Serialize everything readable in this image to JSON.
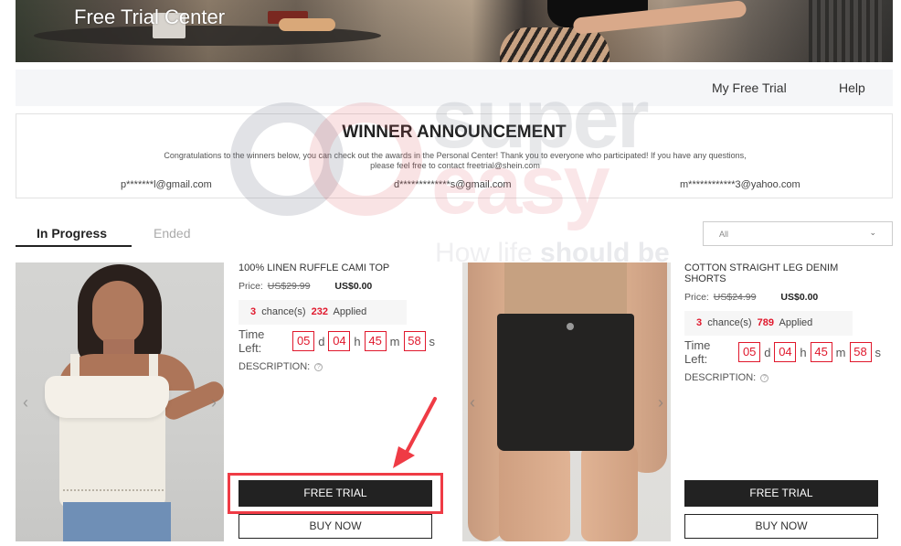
{
  "banner": {
    "title": "Free Trial Center"
  },
  "navbar": {
    "links": [
      {
        "label": "My Free Trial"
      },
      {
        "label": "Help"
      }
    ]
  },
  "announcement": {
    "title": "WINNER ANNOUNCEMENT",
    "text": "Congratulations to the winners below, you can check out the awards in the Personal Center! Thank you to everyone who participated! If you have any questions, please feel free to contact freetrial@shein.com",
    "winners": [
      "p*******l@gmail.com",
      "d*************s@gmail.com",
      "m************3@yahoo.com"
    ]
  },
  "watermark": {
    "line1": "super",
    "line2": "easy",
    "tagline_light": "How life ",
    "tagline_bold": "should be"
  },
  "tabs": [
    {
      "label": "In Progress",
      "active": true
    },
    {
      "label": "Ended",
      "active": false
    }
  ],
  "filter": {
    "selected": "All",
    "chevron": "⌄"
  },
  "icons": {
    "prev": "‹",
    "next": "›",
    "question": "?"
  },
  "products": [
    {
      "name": "100% LINEN RUFFLE CAMI TOP",
      "price_label": "Price:",
      "original_price": "US$29.99",
      "trial_price": "US$0.00",
      "chances": "3",
      "chances_label": "chance(s)",
      "applied": "232",
      "applied_label": "Applied",
      "time_left_label": "Time Left:",
      "time_left": {
        "days": "05",
        "hours": "04",
        "minutes": "45",
        "seconds": "58"
      },
      "units": {
        "d": "d",
        "h": "h",
        "m": "m",
        "s": "s"
      },
      "description_label": "DESCRIPTION:",
      "free_trial_label": "FREE TRIAL",
      "buy_now_label": "BUY NOW",
      "highlighted": true
    },
    {
      "name": "COTTON STRAIGHT LEG DENIM SHORTS",
      "price_label": "Price:",
      "original_price": "US$24.99",
      "trial_price": "US$0.00",
      "chances": "3",
      "chances_label": "chance(s)",
      "applied": "789",
      "applied_label": "Applied",
      "time_left_label": "Time Left:",
      "time_left": {
        "days": "05",
        "hours": "04",
        "minutes": "45",
        "seconds": "58"
      },
      "units": {
        "d": "d",
        "h": "h",
        "m": "m",
        "s": "s"
      },
      "description_label": "DESCRIPTION:",
      "free_trial_label": "FREE TRIAL",
      "buy_now_label": "BUY NOW",
      "highlighted": false
    }
  ],
  "colors": {
    "accent_red": "#e0182c",
    "annotation_red": "#ef3b45",
    "button_dark": "#222222",
    "navbar_bg": "#f5f6f8"
  }
}
